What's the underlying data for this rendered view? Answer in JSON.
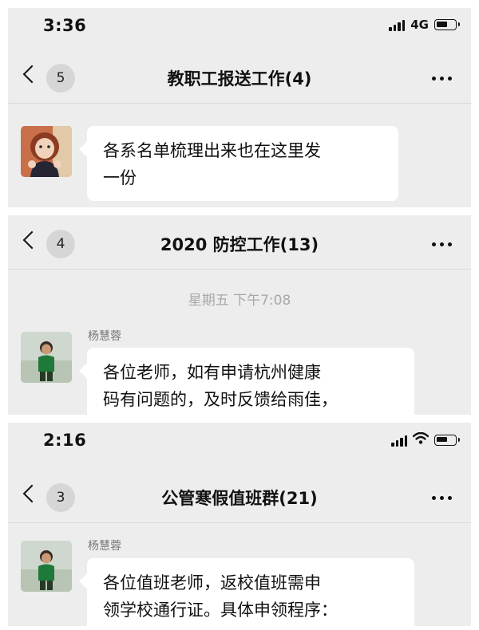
{
  "panels": [
    {
      "status": {
        "time": "3:36",
        "network": "4G"
      },
      "nav": {
        "back_count": "5",
        "title": "教职工报送工作(4)"
      },
      "message": {
        "sender": "",
        "lines": [
          "各系名单梳理出来也在这里发",
          "一份"
        ]
      }
    },
    {
      "nav": {
        "back_count": "4",
        "title": "2020 防控工作(13)"
      },
      "timestamp": "星期五 下午7:08",
      "message": {
        "sender": "杨慧蓉",
        "lines": [
          "各位老师，如有申请杭州健康",
          "码有问题的，及时反馈给雨佳，"
        ]
      }
    },
    {
      "status": {
        "time": "2:16"
      },
      "nav": {
        "back_count": "3",
        "title": "公管寒假值班群(21)"
      },
      "message": {
        "sender": "杨慧蓉",
        "lines": [
          "各位值班老师，返校值班需申",
          "领学校通行证。具体申领程序："
        ]
      }
    }
  ],
  "icons": {
    "back": "chevron-left-icon",
    "more": "more-horizontal-icon",
    "signal": "cellular-signal-icon",
    "wifi": "wifi-icon",
    "battery": "battery-icon"
  }
}
